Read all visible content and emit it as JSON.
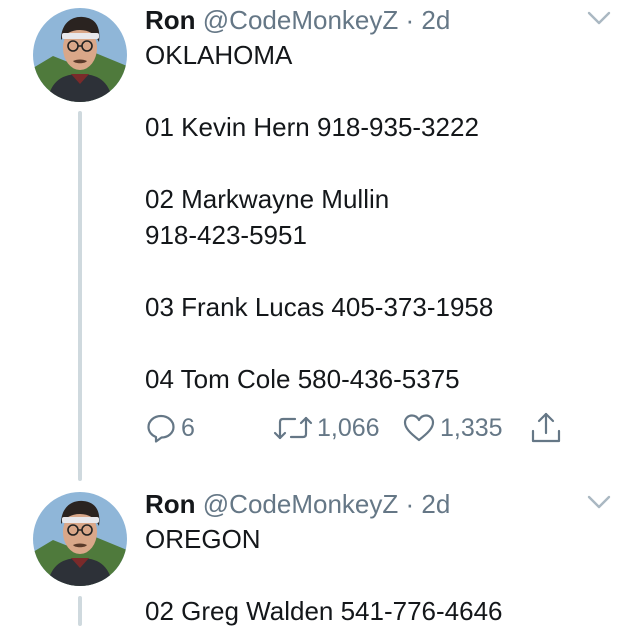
{
  "tweets": [
    {
      "name": "Ron",
      "handle": "@CodeMonkeyZ",
      "separator": "·",
      "time": "2d",
      "lines": [
        "OKLAHOMA",
        "",
        "01 Kevin Hern 918-935-3222",
        "",
        "02 Markwayne Mullin",
        "918-423-5951",
        "",
        "03 Frank Lucas 405-373-1958",
        "",
        "04 Tom Cole 580-436-5375"
      ],
      "replies": "6",
      "retweets": "1,066",
      "likes": "1,335"
    },
    {
      "name": "Ron",
      "handle": "@CodeMonkeyZ",
      "separator": "·",
      "time": "2d",
      "lines": [
        "OREGON",
        "",
        "02 Greg Walden 541-776-4646"
      ]
    }
  ],
  "icons": {
    "reply": "reply-icon",
    "retweet": "retweet-icon",
    "like": "heart-icon",
    "share": "share-icon",
    "caret": "chevron-down-icon"
  },
  "colors": {
    "text": "#14171a",
    "secondary": "#657786",
    "thread_line": "#cfd9de"
  }
}
